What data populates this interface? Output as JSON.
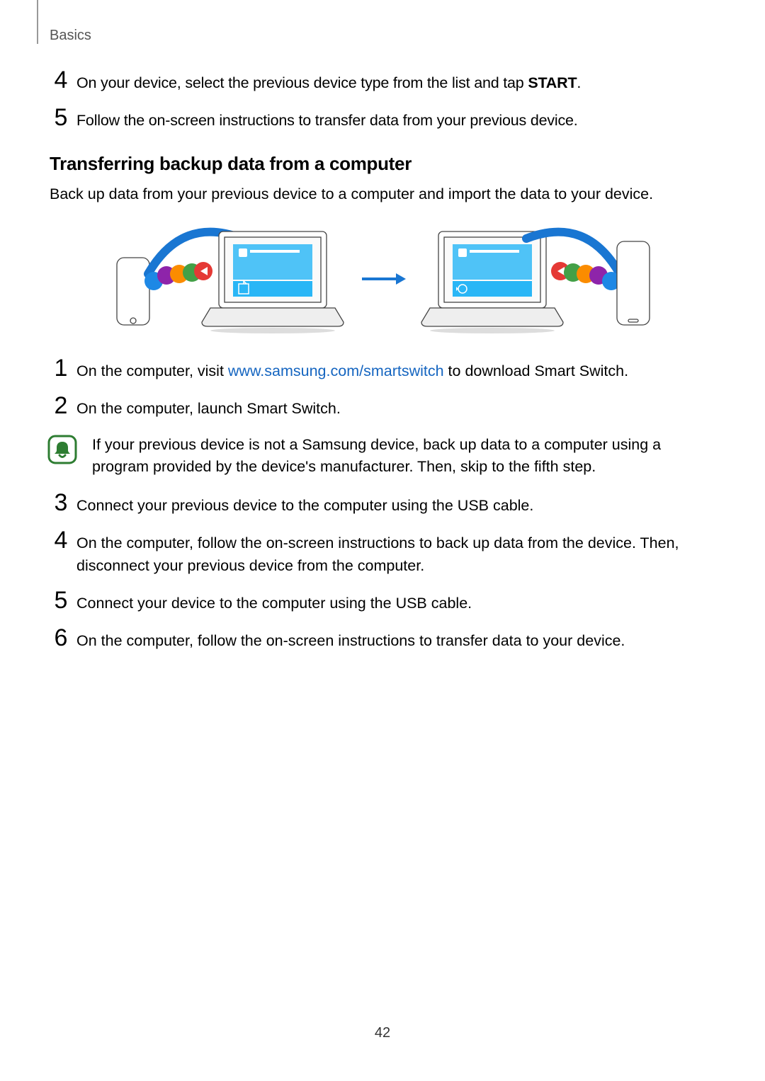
{
  "header": {
    "section": "Basics"
  },
  "top_steps": [
    {
      "n": "4",
      "pre": "On your device, select the previous device type from the list and tap ",
      "bold": "START",
      "post": "."
    },
    {
      "n": "5",
      "text": "Follow the on-screen instructions to transfer data from your previous device."
    }
  ],
  "heading": "Transferring backup data from a computer",
  "intro": "Back up data from your previous device to a computer and import the data to your device.",
  "steps2": [
    {
      "n": "1",
      "pre": "On the computer, visit ",
      "link": "www.samsung.com/smartswitch",
      "post": " to download Smart Switch."
    },
    {
      "n": "2",
      "text": "On the computer, launch Smart Switch."
    }
  ],
  "note": "If your previous device is not a Samsung device, back up data to a computer using a program provided by the device's manufacturer. Then, skip to the fifth step.",
  "steps3": [
    {
      "n": "3",
      "text": "Connect your previous device to the computer using the USB cable."
    },
    {
      "n": "4",
      "text": "On the computer, follow the on-screen instructions to back up data from the device. Then, disconnect your previous device from the computer."
    },
    {
      "n": "5",
      "text": "Connect your device to the computer using the USB cable."
    },
    {
      "n": "6",
      "text": "On the computer, follow the on-screen instructions to transfer data to your device."
    }
  ],
  "page_number": "42"
}
